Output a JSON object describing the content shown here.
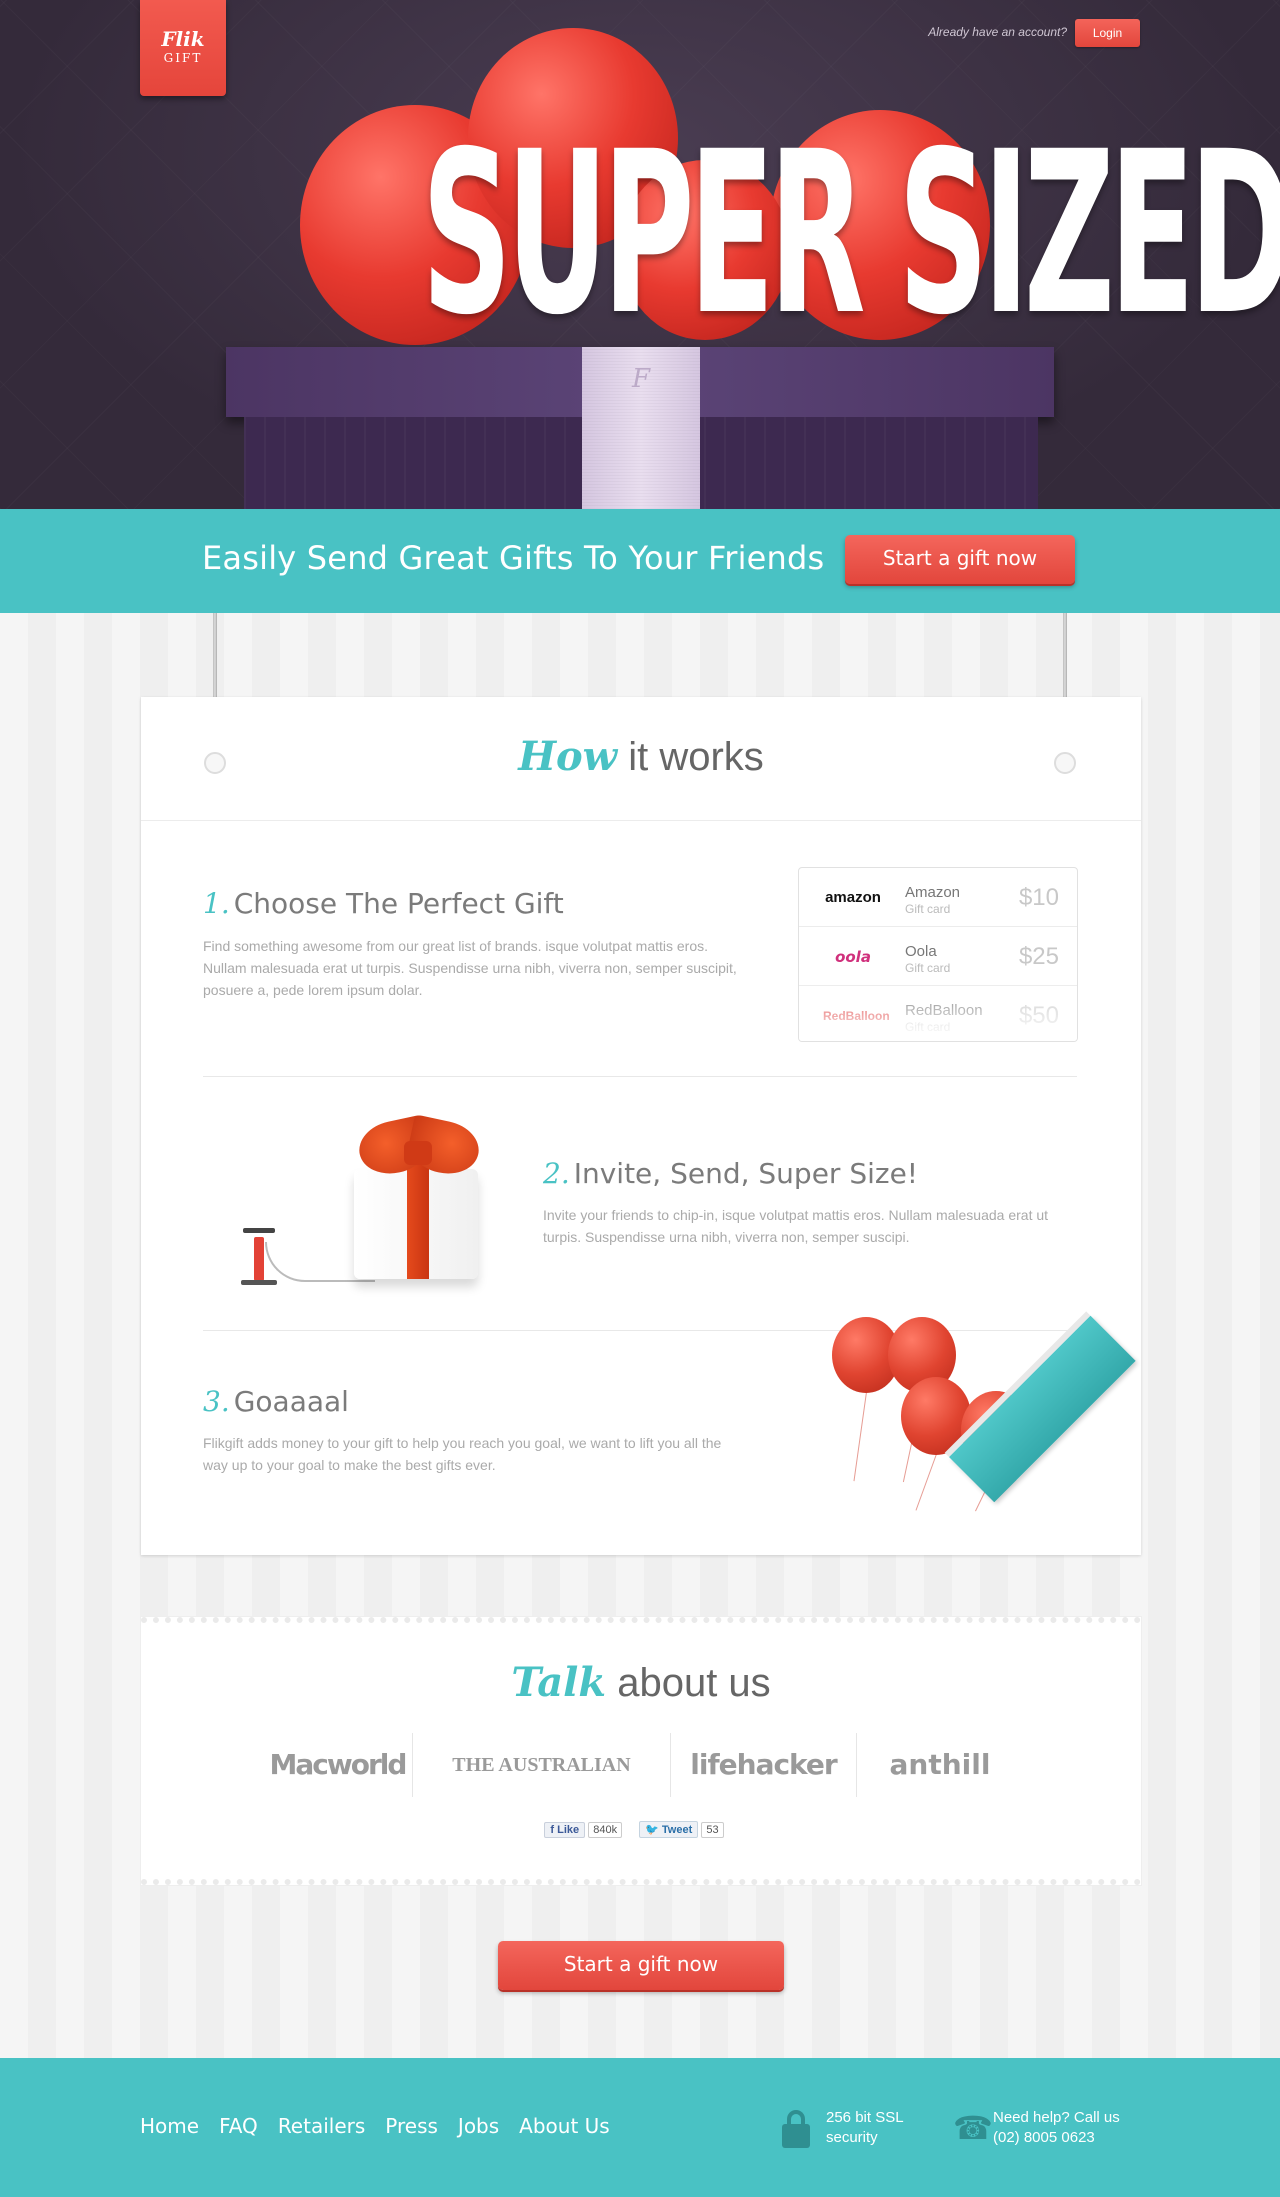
{
  "brand": {
    "line1": "Flik",
    "line2": "GIFT"
  },
  "header": {
    "account_text": "Already have an account?",
    "login_label": "Login"
  },
  "hero": {
    "headline": "SUPER SIZED",
    "ribbon_letter": "F"
  },
  "banner": {
    "text": "Easily Send Great Gifts To Your Friends",
    "cta_label": "Start a gift now"
  },
  "how_it_works": {
    "title_script": "How",
    "title_rest": "it works",
    "steps": [
      {
        "num": "1.",
        "title": "Choose The Perfect Gift",
        "body": "Find something awesome from our great list of brands. isque volutpat mattis eros. Nullam malesuada erat ut turpis. Suspendisse urna nibh, viverra non, semper suscipit, posuere a, pede lorem ipsum dolar."
      },
      {
        "num": "2.",
        "title": "Invite, Send, Super Size!",
        "body": "Invite your friends to chip-in, isque volutpat mattis eros. Nullam malesuada erat ut turpis. Suspendisse urna nibh, viverra non, semper suscipi."
      },
      {
        "num": "3.",
        "title": "Goaaaal",
        "body": "Flikgift adds money to your gift to help you reach you goal, we want to lift you all the way up to your goal to make the best gifts ever."
      }
    ],
    "gift_cards": [
      {
        "logo": "amazon",
        "name": "Amazon",
        "sub": "Gift card",
        "price": "$10"
      },
      {
        "logo": "oola",
        "name": "Oola",
        "sub": "Gift card",
        "price": "$25"
      },
      {
        "logo": "RedBalloon",
        "name": "RedBalloon",
        "sub": "Gift card",
        "price": "$50"
      }
    ]
  },
  "press": {
    "title_script": "Talk",
    "title_rest": "about us",
    "logos": [
      "Macworld",
      "THE AUSTRALIAN",
      "lifehacker",
      "anthill"
    ],
    "social": {
      "like_label": "Like",
      "like_count": "840k",
      "tweet_label": "Tweet",
      "tweet_count": "53"
    }
  },
  "bottom_cta": {
    "label": "Start a gift now"
  },
  "footer": {
    "nav": [
      "Home",
      "FAQ",
      "Retailers",
      "Press",
      "Jobs",
      "About Us"
    ],
    "ssl_line1": "256 bit SSL",
    "ssl_line2": "security",
    "help_line1": "Need help? Call us",
    "help_line2": "(02) 8005 0623"
  },
  "colors": {
    "accent_teal": "#49c2c4",
    "cta_red": "#e94b40",
    "hero_bg": "#3b3040"
  },
  "icons": [
    "lock-icon",
    "phone-icon",
    "facebook-icon",
    "twitter-icon"
  ]
}
